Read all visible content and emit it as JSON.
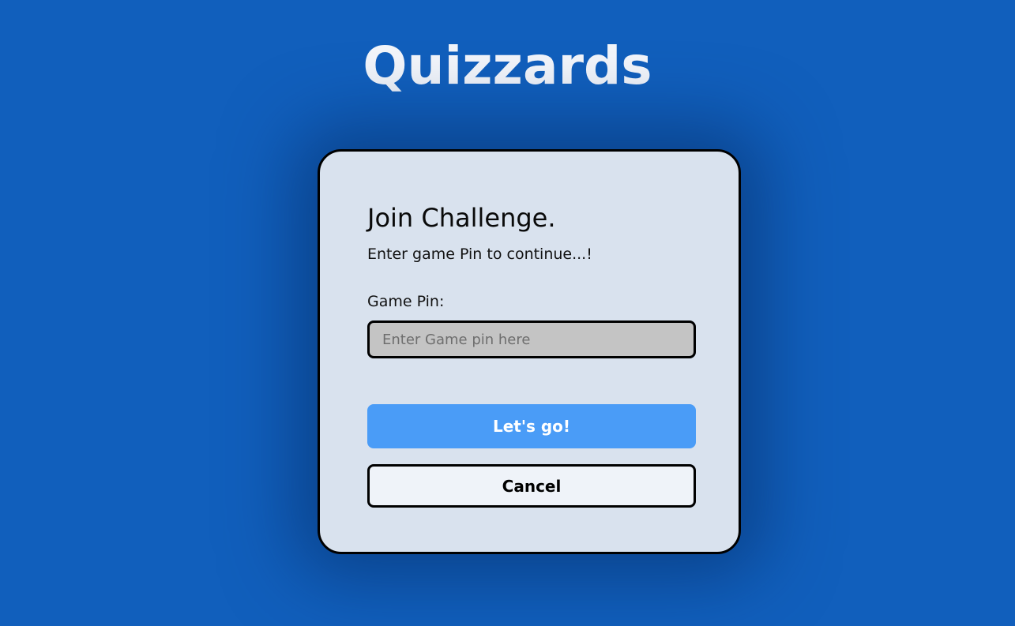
{
  "app": {
    "title": "Quizzards"
  },
  "join_card": {
    "title": "Join Challenge.",
    "subtitle": "Enter game Pin to continue...!",
    "pin_label": "Game Pin:",
    "pin_value": "",
    "pin_placeholder": "Enter Game pin here",
    "go_label": "Let's go!",
    "cancel_label": "Cancel"
  },
  "colors": {
    "background": "#115fbc",
    "card": "#d9e2ee",
    "primary_button": "#4a9cf7",
    "input": "#c4c4c4"
  }
}
